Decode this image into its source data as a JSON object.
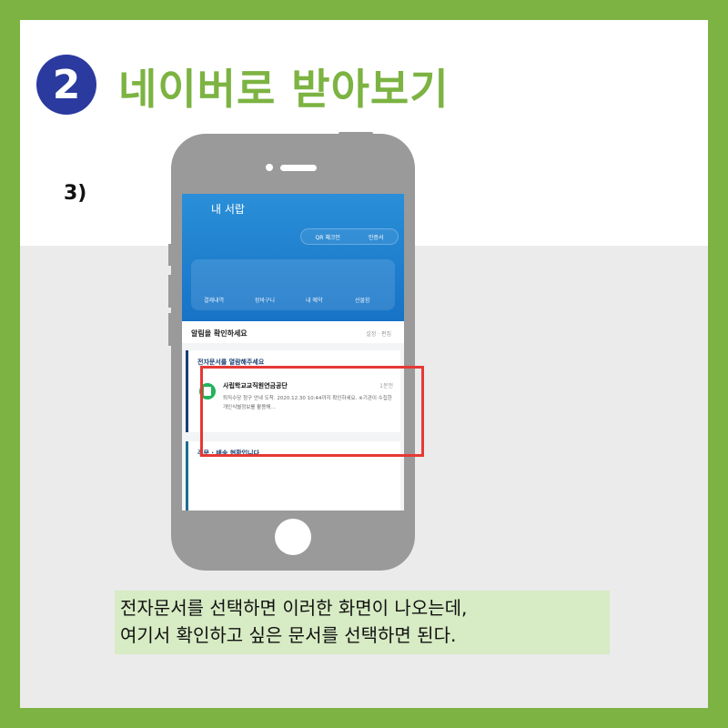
{
  "header": {
    "step_number": "2",
    "title": "네이버로 받아보기"
  },
  "step_label": "3)",
  "phone_screen": {
    "drawer_title": "내 서랍",
    "chips": [
      "QR 체크인",
      "인증서"
    ],
    "menu_items": [
      "결제내역",
      "장바구니",
      "내 예약",
      "선물함"
    ],
    "notice_label": "알림을 확인하세요",
    "notice_actions": "설정 · 편집",
    "card1": {
      "heading": "전자문서를 열람해주세요",
      "sender": "사립학교교직원연금공단",
      "time": "1분전",
      "preview": "퇴직수당 청구 안내 도착. 2020.12.30 10:44까지 확인하세요. ※기관이 수집한 개인식별정보를 활용해…"
    },
    "card2": {
      "heading": "주문 · 배송 현황입니다"
    }
  },
  "caption": {
    "line1": "전자문서를 선택하면 이러한 화면이 나오는데,",
    "line2": "여기서 확인하고 싶은 문서를 선택하면 된다."
  },
  "colors": {
    "accent_green": "#7cb342",
    "badge_blue": "#2b3a9f",
    "highlight_red": "#e53935"
  }
}
